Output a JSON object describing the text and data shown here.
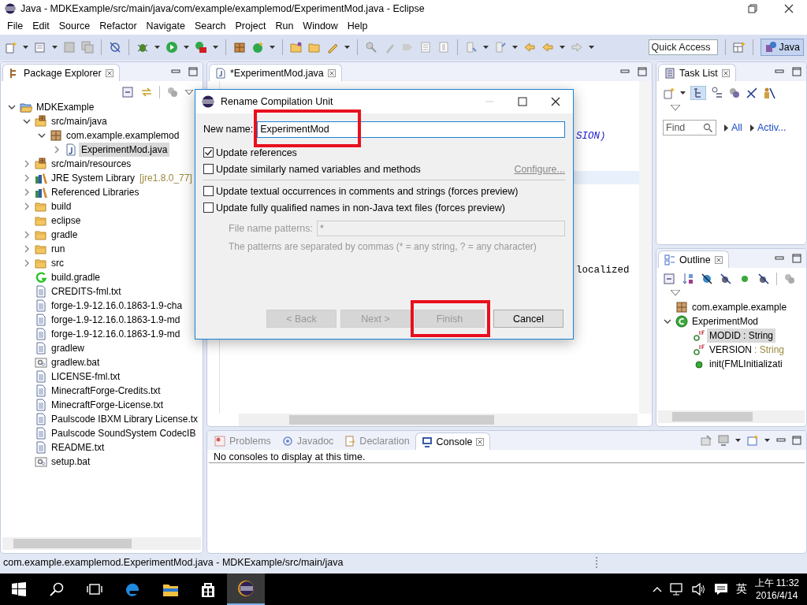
{
  "window": {
    "title": "Java - MDKExample/src/main/java/com/example/examplemod/ExperimentMod.java - Eclipse"
  },
  "menu": [
    "File",
    "Edit",
    "Source",
    "Refactor",
    "Navigate",
    "Search",
    "Project",
    "Run",
    "Window",
    "Help"
  ],
  "toolbar": {
    "quick_access": {
      "placeholder": "Quick Access"
    },
    "perspective": {
      "label": "Java",
      "selected": true
    }
  },
  "package_explorer": {
    "title": "Package Explorer",
    "tree": [
      {
        "label": "MDKExample",
        "kind": "project",
        "expanded": true,
        "selected": false,
        "children": [
          {
            "label": "src/main/java",
            "kind": "srcfolder",
            "expanded": true,
            "selected": false,
            "children": [
              {
                "label": "com.example.examplemod",
                "kind": "package",
                "expanded": true,
                "selected": false,
                "children": [
                  {
                    "label": "ExperimentMod.java",
                    "kind": "java",
                    "expanded": false,
                    "selected": true
                  }
                ]
              }
            ]
          },
          {
            "label": "src/main/resources",
            "kind": "srcfolder",
            "expanded": false,
            "selected": false
          },
          {
            "label": "JRE System Library",
            "kind": "library",
            "expanded": false,
            "selected": false,
            "decoration": "[jre1.8.0_77]"
          },
          {
            "label": "Referenced Libraries",
            "kind": "library",
            "expanded": false,
            "selected": false
          },
          {
            "label": "build",
            "kind": "folder",
            "expanded": false,
            "selected": false
          },
          {
            "label": "eclipse",
            "kind": "folder",
            "selected": false
          },
          {
            "label": "gradle",
            "kind": "folder",
            "expanded": false,
            "selected": false
          },
          {
            "label": "run",
            "kind": "folder",
            "expanded": false,
            "selected": false
          },
          {
            "label": "src",
            "kind": "folder",
            "expanded": false,
            "selected": false
          },
          {
            "label": "build.gradle",
            "kind": "gradle",
            "selected": false
          },
          {
            "label": "CREDITS-fml.txt",
            "kind": "text",
            "selected": false
          },
          {
            "label": "forge-1.9-12.16.0.1863-1.9-cha",
            "kind": "text",
            "selected": false
          },
          {
            "label": "forge-1.9-12.16.0.1863-1.9-md",
            "kind": "text",
            "selected": false
          },
          {
            "label": "forge-1.9-12.16.0.1863-1.9-md",
            "kind": "text",
            "selected": false
          },
          {
            "label": "gradlew",
            "kind": "text",
            "selected": false
          },
          {
            "label": "gradlew.bat",
            "kind": "script",
            "selected": false
          },
          {
            "label": "LICENSE-fml.txt",
            "kind": "text",
            "selected": false
          },
          {
            "label": "MinecraftForge-Credits.txt",
            "kind": "text",
            "selected": false
          },
          {
            "label": "MinecraftForge-License.txt",
            "kind": "text",
            "selected": false
          },
          {
            "label": "Paulscode IBXM Library License.tx",
            "kind": "text",
            "selected": false
          },
          {
            "label": "Paulscode SoundSystem CodecIB",
            "kind": "text",
            "selected": false
          },
          {
            "label": "README.txt",
            "kind": "text",
            "selected": false
          },
          {
            "label": "setup.bat",
            "kind": "script",
            "selected": false
          }
        ]
      }
    ]
  },
  "editor": {
    "tabs": [
      {
        "label": "*ExperimentMod.java",
        "selected": true
      }
    ],
    "code_fragments": [
      {
        "text": "SION)",
        "kind": "constant"
      },
      {
        "text": "localized",
        "kind": "plain"
      }
    ]
  },
  "task_list": {
    "title": "Task List",
    "find": {
      "placeholder": "Find"
    },
    "filters": [
      "All",
      "Activ..."
    ]
  },
  "outline": {
    "title": "Outline",
    "tree": [
      {
        "label": "com.example.example",
        "kind": "package",
        "selected": false
      },
      {
        "label": "ExperimentMod",
        "kind": "class",
        "expanded": true,
        "selected": false,
        "children": [
          {
            "label": "MODID",
            "detail": " : String",
            "kind": "field",
            "selected": true
          },
          {
            "label": "VERSION",
            "detail": " : String",
            "kind": "field",
            "selected": false
          },
          {
            "label": "init(FMLInitializati",
            "kind": "method",
            "selected": false
          }
        ]
      }
    ]
  },
  "console": {
    "tabs": [
      {
        "label": "Problems",
        "kind": "problems",
        "selected": false
      },
      {
        "label": "Javadoc",
        "kind": "javadoc",
        "selected": false
      },
      {
        "label": "Declaration",
        "kind": "declaration",
        "selected": false
      },
      {
        "label": "Console",
        "kind": "console",
        "selected": true
      }
    ],
    "message": "No consoles to display at this time."
  },
  "dialog": {
    "title": "Rename Compilation Unit",
    "new_name": {
      "label": "New name:",
      "value": "ExperimentMod",
      "highlighted": true
    },
    "options": [
      {
        "label": "Update references",
        "checked": true
      },
      {
        "label": "Update similarly named variables and methods",
        "checked": false,
        "link": "Configure..."
      },
      {
        "label": "Update textual occurrences in comments and strings (forces preview)",
        "checked": false
      },
      {
        "label": "Update fully qualified names in non-Java text files (forces preview)",
        "checked": false
      }
    ],
    "patterns": {
      "label": "File name patterns:",
      "value": "*",
      "disabled": true
    },
    "hint": "The patterns are separated by commas (* = any string, ? = any character)",
    "buttons": [
      {
        "label": "< Back",
        "disabled": true,
        "highlighted": false
      },
      {
        "label": "Next >",
        "disabled": true,
        "highlighted": false
      },
      {
        "label": "Finish",
        "disabled": true,
        "highlighted": true
      },
      {
        "label": "Cancel",
        "disabled": false,
        "highlighted": false
      }
    ]
  },
  "status_bar": {
    "text": "com.example.examplemod.ExperimentMod.java - MDKExample/src/main/java"
  },
  "taskbar": {
    "apps": [
      {
        "kind": "browser",
        "selected": false
      },
      {
        "kind": "files",
        "selected": false
      },
      {
        "kind": "store",
        "selected": false
      },
      {
        "kind": "eclipse",
        "selected": true
      }
    ],
    "ime": "英",
    "time": "上午 11:32",
    "date": "2016/4/14"
  }
}
